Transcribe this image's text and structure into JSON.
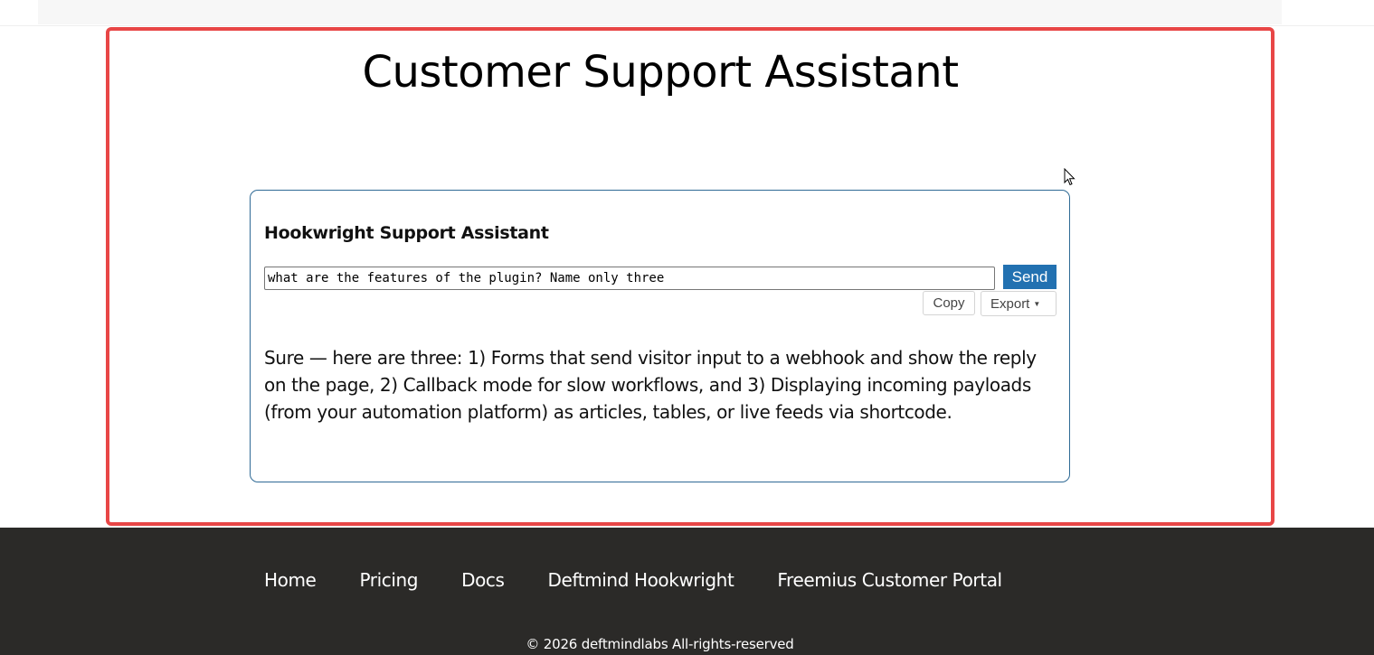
{
  "page": {
    "title": "Customer Support Assistant"
  },
  "assistant": {
    "title": "Hookwright Support Assistant",
    "query_value": "what are the features of the plugin? Name only three",
    "send_label": "Send",
    "copy_label": "Copy",
    "export_label": "Export",
    "answer": "Sure — here are three: 1) Forms that send visitor input to a webhook and show the reply on the page, 2) Callback mode for slow workflows, and 3) Displaying incoming payloads (from your automation platform) as articles, tables, or live feeds via shortcode."
  },
  "footer": {
    "links": [
      {
        "label": "Home"
      },
      {
        "label": "Pricing"
      },
      {
        "label": "Docs"
      },
      {
        "label": "Deftmind Hookwright"
      },
      {
        "label": "Freemius Customer Portal"
      }
    ],
    "copyright": "© 2026  deftmindlabs  All-rights-reserved"
  },
  "colors": {
    "accent": "#2271b1",
    "highlight_border": "#e84646",
    "card_border": "#2f6a95",
    "footer_bg": "#2b2a28"
  },
  "icons": {
    "cursor": "mouse-pointer-icon",
    "export_caret": "caret-down-icon"
  }
}
